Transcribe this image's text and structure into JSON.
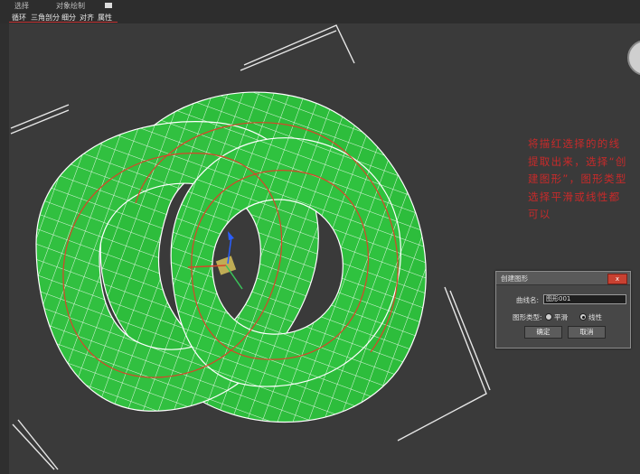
{
  "menubar": {
    "top_items": [
      "选择",
      "对象绘制"
    ],
    "items": [
      "循环",
      "三角剖分",
      "细分",
      "对齐",
      "属性"
    ]
  },
  "annotation": {
    "text": "将描红选择的的线提取出来，选择“创建图形”，图形类型选择平滑或线性都可以"
  },
  "dialog": {
    "title": "创建图形",
    "close_label": "x",
    "curve_name_label": "曲线名:",
    "curve_name_value": "图形001",
    "shape_type_label": "图形类型:",
    "option_smooth": "平滑",
    "option_linear": "线性",
    "selected_option": "linear",
    "ok_label": "确定",
    "cancel_label": "取消"
  },
  "colors": {
    "mesh_green": "#2dbd3c",
    "wire": "#ffffff",
    "accent_red": "#c82a2a",
    "background": "#3a3a3a"
  }
}
